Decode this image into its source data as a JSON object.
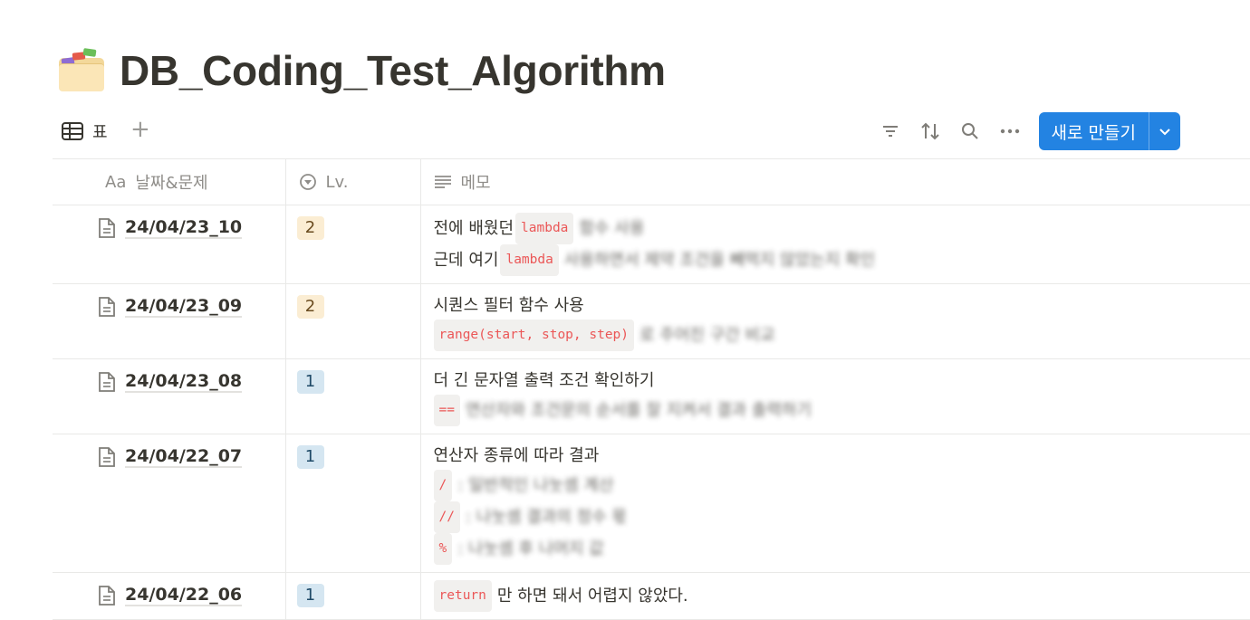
{
  "page": {
    "title": "DB_Coding_Test_Algorithm"
  },
  "view": {
    "tab_label": "표",
    "add_view": "+"
  },
  "toolbar": {
    "new_button_label": "새로 만들기"
  },
  "columns": {
    "name": "날짜&문제",
    "level": "Lv.",
    "memo": "메모",
    "name_prefix": "Aa"
  },
  "rows": [
    {
      "name": "24/04/23_10",
      "level": "2",
      "memo": [
        {
          "text": "전에 배웠던",
          "code": "lambda",
          "rest": "함수 사용"
        },
        {
          "text": "근데 여기",
          "code": "lambda",
          "rest": "사용하면서 제약 조건을 빼먹지 않았는지 확인"
        }
      ]
    },
    {
      "name": "24/04/23_09",
      "level": "2",
      "memo": [
        {
          "text": "시퀀스 필터 함수 사용",
          "code": "",
          "rest": ""
        },
        {
          "text": "",
          "code": "range(start, stop, step)",
          "rest": "로 주어진 구간 비교"
        }
      ]
    },
    {
      "name": "24/04/23_08",
      "level": "1",
      "memo": [
        {
          "text": "더 긴 문자열 출력 조건 확인하기",
          "code": "",
          "rest": ""
        },
        {
          "text": "",
          "code": "==",
          "rest": "연산자와 조건문의 순서를 잘 지켜서 결과 출력하기"
        }
      ]
    },
    {
      "name": "24/04/22_07",
      "level": "1",
      "memo": [
        {
          "text": "연산자 종류에 따라 결과",
          "code": "",
          "rest": ""
        },
        {
          "text": "",
          "code": "/",
          "rest": ": 일반적인 나눗셈 계산"
        },
        {
          "text": "",
          "code": "//",
          "rest": ": 나눗셈 결과의 정수 몫"
        },
        {
          "text": "",
          "code": "%",
          "rest": ": 나눗셈 후 나머지 값"
        }
      ]
    },
    {
      "name": "24/04/22_06",
      "level": "1",
      "memo": [
        {
          "text": "",
          "code": "return",
          "rest": "만 하면 돼서 어렵지 않았다."
        }
      ]
    }
  ]
}
